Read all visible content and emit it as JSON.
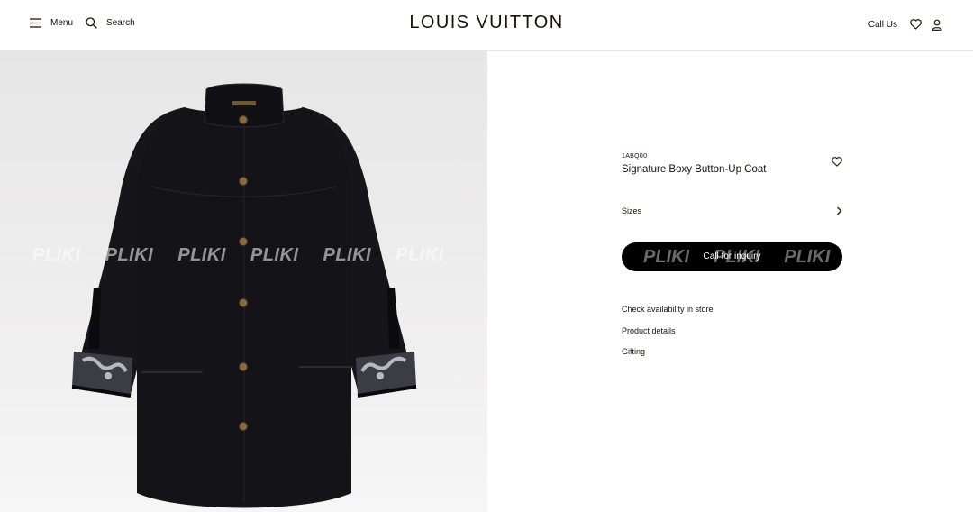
{
  "header": {
    "menu_label": "Menu",
    "search_label": "Search",
    "brand": "LOUIS VUITTON",
    "call_us": "Call Us",
    "icons": [
      "menu-icon",
      "search-icon",
      "heart-icon",
      "user-icon"
    ]
  },
  "image": {
    "watermark": [
      "PLIKI",
      "PLIKI",
      "PLIKI",
      "PLIKI",
      "PLIKI",
      "PLIKI"
    ]
  },
  "product": {
    "sku": "1ABQ00",
    "name": "Signature Boxy Button-Up Coat",
    "sizes_label": "Sizes",
    "cta_label": "Call for inquiry",
    "cta_watermark": [
      "PLIKI",
      "PLIKI",
      "PLIKI"
    ],
    "links": [
      "Check availability in store",
      "Product details",
      "Gifting"
    ]
  },
  "colors": {
    "text": "#19110b",
    "cta_bg": "#000000",
    "image_bg": "#eceaea"
  }
}
